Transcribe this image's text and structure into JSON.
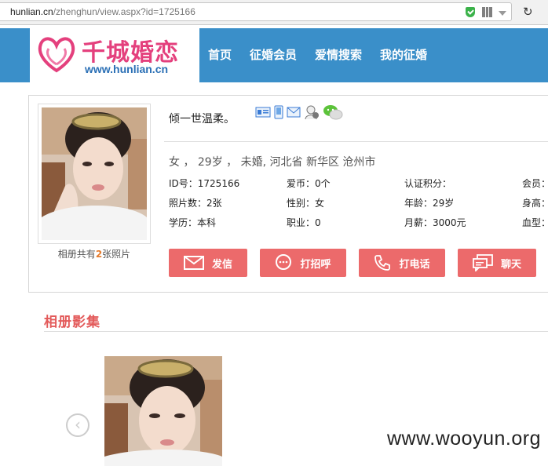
{
  "browser": {
    "url_host": "hunlian.cn",
    "url_path": "/zhenghun/view.aspx?id=1725166"
  },
  "site": {
    "logo_text": "千城婚恋",
    "logo_url": "www.hunlian.cn",
    "brand_color": "#3a8fc9",
    "accent_color": "#ec6a6b",
    "nav": [
      "首页",
      "征婚会员",
      "爱情搜索",
      "我的征婚"
    ]
  },
  "profile": {
    "album_count_prefix": "相册共有",
    "album_count_number": "2",
    "album_count_suffix": "张照片",
    "nickname": "倾一世温柔。",
    "summary": "女 ， 29岁 ， 未婚, 河北省 新华区 沧州市",
    "rows": [
      [
        {
          "label": "ID号：",
          "value": "1725166"
        },
        {
          "label": "爱币：",
          "value": "0个"
        },
        {
          "label": "认证积分：",
          "value": ""
        },
        {
          "label": "会员：",
          "value": ""
        }
      ],
      [
        {
          "label": "照片数：",
          "value": "2张"
        },
        {
          "label": "性别：",
          "value": "女"
        },
        {
          "label": "年龄：",
          "value": "29岁"
        },
        {
          "label": "身高：",
          "value": ""
        }
      ],
      [
        {
          "label": "学历：",
          "value": "本科"
        },
        {
          "label": "职业：",
          "value": "0"
        },
        {
          "label": "月薪：",
          "value": "3000元"
        },
        {
          "label": "血型：",
          "value": ""
        }
      ]
    ],
    "buttons": [
      {
        "label": "发信",
        "icon": "envelope-icon"
      },
      {
        "label": "打招呼",
        "icon": "chat-bubble-icon"
      },
      {
        "label": "打电话",
        "icon": "phone-icon"
      },
      {
        "label": "聊天",
        "icon": "chat-window-icon"
      }
    ]
  },
  "album": {
    "title": "相册影集"
  },
  "watermark": "www.wooyun.org"
}
